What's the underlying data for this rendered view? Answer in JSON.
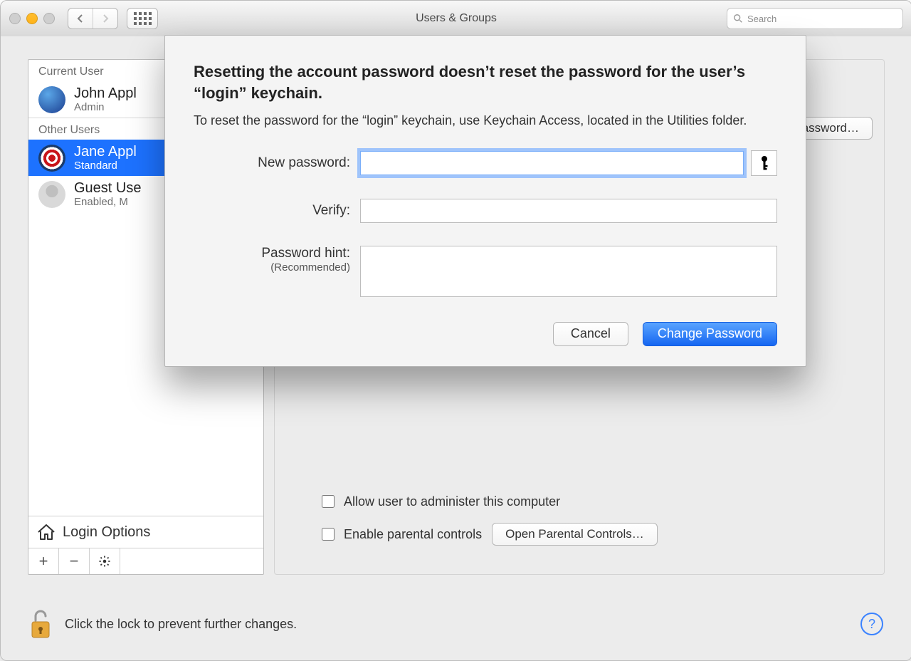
{
  "titlebar": {
    "title": "Users & Groups",
    "search_placeholder": "Search"
  },
  "sidebar": {
    "current_user_header": "Current User",
    "other_users_header": "Other Users",
    "users": [
      {
        "name": "John Appleseed",
        "role": "Admin",
        "truncated": "John Appl"
      },
      {
        "name": "Jane Appleseed",
        "role": "Standard",
        "truncated": "Jane Appl"
      },
      {
        "name": "Guest User",
        "role": "Enabled, Managed",
        "truncated": "Guest Use",
        "role_truncated": "Enabled, M"
      }
    ],
    "login_options": "Login Options"
  },
  "main": {
    "change_password_btn": "Change Password…",
    "change_password_truncated": "assword…",
    "allow_admin": "Allow user to administer this computer",
    "enable_parental": "Enable parental controls",
    "open_parental": "Open Parental Controls…"
  },
  "footer": {
    "lock_text": "Click the lock to prevent further changes."
  },
  "sheet": {
    "heading": "Resetting the account password doesn’t reset the password for the user’s “login” keychain.",
    "subtext": "To reset the password for the “login” keychain, use Keychain Access, located in the Utilities folder.",
    "labels": {
      "new_password": "New password:",
      "verify": "Verify:",
      "hint": "Password hint:",
      "hint_sub": "(Recommended)"
    },
    "values": {
      "new_password": "",
      "verify": "",
      "hint": ""
    },
    "cancel": "Cancel",
    "change": "Change Password"
  }
}
